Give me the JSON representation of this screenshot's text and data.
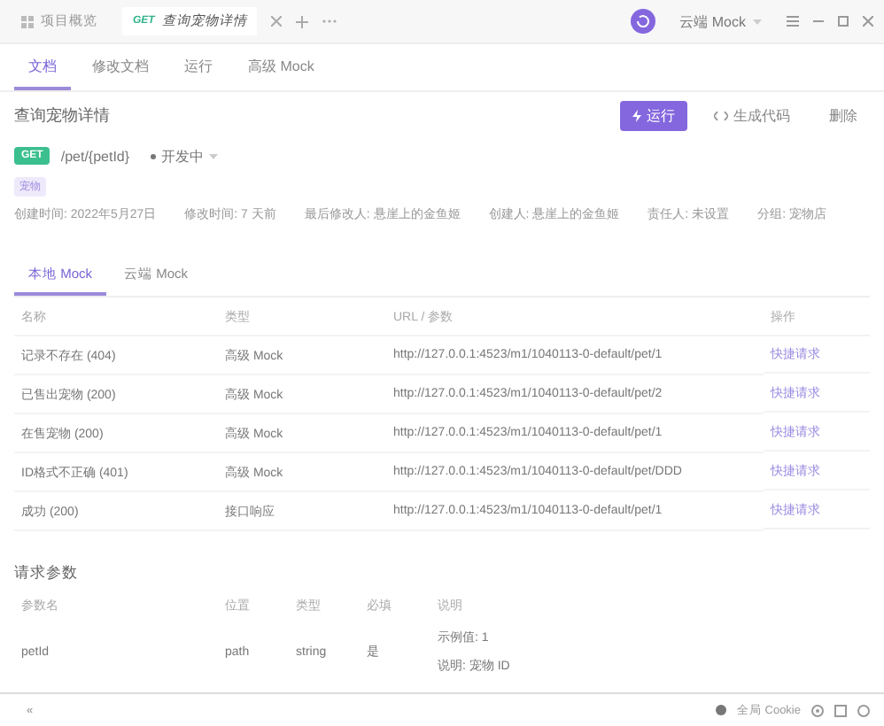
{
  "title_bar": {
    "tabs": [
      {
        "label": "项目概览",
        "selected": false
      },
      {
        "method": "GET",
        "label": "查询宠物详情",
        "selected": true
      }
    ],
    "environment": "云端 Mock"
  },
  "doc_tabs": [
    {
      "label": "文档",
      "selected": true
    },
    {
      "label": "修改文档",
      "selected": false
    },
    {
      "label": "运行",
      "selected": false
    },
    {
      "label": "高级 Mock",
      "selected": false
    }
  ],
  "api": {
    "name": "查询宠物详情",
    "buttons": [
      {
        "label": "运行",
        "kind": "primary"
      },
      {
        "label": "生成代码",
        "kind": "code"
      },
      {
        "label": "删除",
        "kind": "plain"
      }
    ],
    "method": "GET",
    "path": "/pet/{petId}",
    "status": "开发中",
    "tag": "宠物",
    "meta": [
      "创建时间: 2022年5月27日",
      "修改时间: 7 天前",
      "最后修改人: 悬崖上的金鱼姬",
      "创建人: 悬崖上的金鱼姬",
      "责任人: 未设置",
      "分组: 宠物店"
    ]
  },
  "mock_tabs": [
    {
      "label": "本地 Mock",
      "selected": true
    },
    {
      "label": "云端 Mock",
      "selected": false
    }
  ],
  "mock_table": {
    "columns": [
      "名称",
      "类型",
      "URL / 参数",
      "操作"
    ],
    "rows": [
      {
        "name": "记录不存在 (404)",
        "type": "高级 Mock",
        "url": "http://127.0.0.1:4523/m1/1040113-0-default/pet/1",
        "action": "快捷请求"
      },
      {
        "name": "已售出宠物 (200)",
        "type": "高级 Mock",
        "url": "http://127.0.0.1:4523/m1/1040113-0-default/pet/2",
        "action": "快捷请求"
      },
      {
        "name": "在售宠物 (200)",
        "type": "高级 Mock",
        "url": "http://127.0.0.1:4523/m1/1040113-0-default/pet/1",
        "action": "快捷请求"
      },
      {
        "name": "ID格式不正确 (401)",
        "type": "高级 Mock",
        "url": "http://127.0.0.1:4523/m1/1040113-0-default/pet/DDD",
        "action": "快捷请求"
      },
      {
        "name": "成功 (200)",
        "type": "接口响应",
        "url": "http://127.0.0.1:4523/m1/1040113-0-default/pet/1",
        "action": "快捷请求"
      }
    ]
  },
  "params": {
    "title": "请求参数",
    "columns": [
      "参数名",
      "位置",
      "类型",
      "必填",
      "说明"
    ],
    "rows": [
      {
        "name": "petId",
        "location": "path",
        "type": "string",
        "required": "是",
        "example_label": "示例值:",
        "example": "1",
        "desc_label": "说明:",
        "desc": "宠物 ID"
      }
    ]
  },
  "footer": {
    "collapse": "«",
    "cookie": "全局 Cookie"
  }
}
